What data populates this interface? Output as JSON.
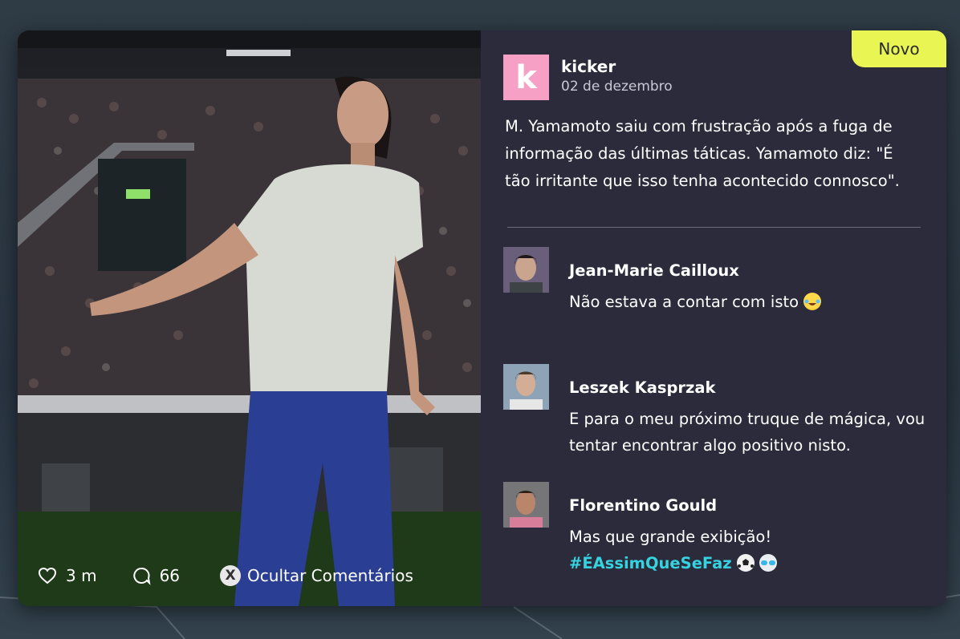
{
  "post": {
    "author": "kicker",
    "logo_letter": "k",
    "date": "02 de dezembro",
    "badge": "Novo",
    "text": "M. Yamamoto saiu com frustração após a fuga de informação das últimas táticas. Yamamoto diz: \"É tão irritante que isso tenha acontecido connosco\"."
  },
  "comments": [
    {
      "name": "Jean-Marie Cailloux",
      "text": "Não estava a contar com isto",
      "emoji": "laughing-tears-emoji"
    },
    {
      "name": "Leszek Kasprzak",
      "text": "E para o meu próximo truque de mágica, vou tentar encontrar algo positivo nisto."
    },
    {
      "name": "Florentino Gould",
      "text": "Mas que grande exibição!",
      "hashtag": "#ÉAssimQueSeFaz",
      "emojis": [
        "soccer-ball-emoji",
        "goggles-emoji"
      ]
    }
  ],
  "footer": {
    "likes": "3 m",
    "comments_count": "66",
    "hide_button_key": "X",
    "hide_label": "Ocultar Comentários"
  },
  "colors": {
    "badge": "#e8f553",
    "logo": "#f5a0c4",
    "panel": "#2c2b3b",
    "hashtag": "#35d3e0"
  }
}
